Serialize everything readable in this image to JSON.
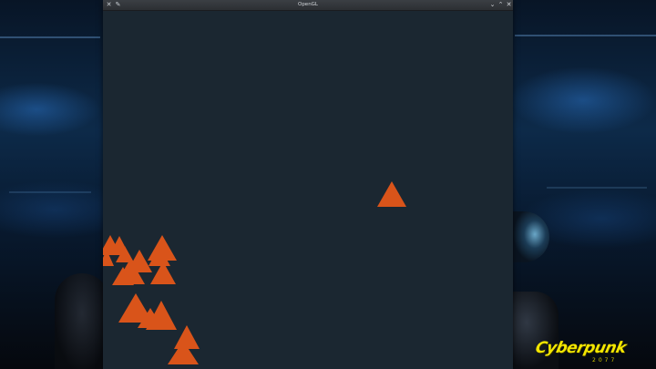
{
  "window": {
    "title": "OpenGL",
    "app_menu_icon": "window-menu-icon",
    "pin_icon": "pin-icon",
    "minimize_icon": "chevron-down-icon",
    "maximize_icon": "chevron-up-icon",
    "close_icon": "close-icon",
    "minimize_glyph": "⌄",
    "maximize_glyph": "⌃",
    "close_glyph": "✕",
    "menu_glyph": "✕",
    "pin_glyph": "✎"
  },
  "scene": {
    "background_color": "#1b2731",
    "triangle_color": "#d9541a",
    "triangle_count": 16
  },
  "wallpaper": {
    "logo_text": "Cyberpunk",
    "logo_sub": "2077",
    "logo_color": "#f3e600"
  }
}
